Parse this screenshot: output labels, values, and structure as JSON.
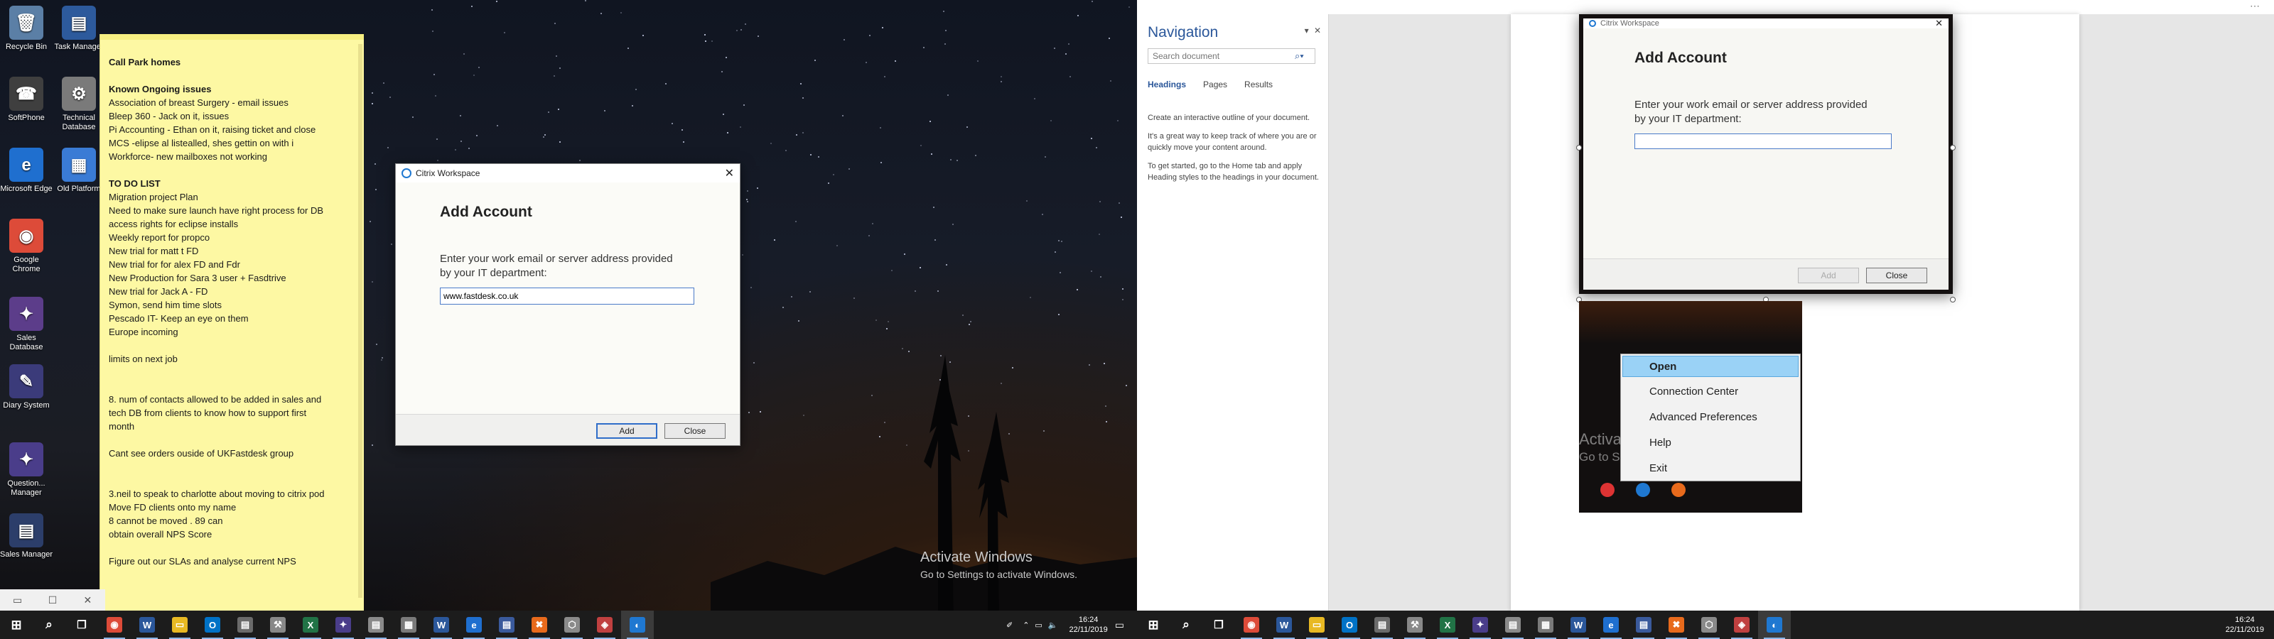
{
  "desktop_icons": [
    {
      "label": "Recycle Bin",
      "glyph": "🗑",
      "color": "#5b7fa6"
    },
    {
      "label": "Task Manager",
      "glyph": "▤",
      "color": "#2d5a9c"
    },
    {
      "label": "SoftPhone",
      "glyph": "☎",
      "color": "#3f3f3f"
    },
    {
      "label": "Technical Database",
      "glyph": "⚙",
      "color": "#7a7a7a"
    },
    {
      "label": "Microsoft Edge",
      "glyph": "e",
      "color": "#1f6fcf"
    },
    {
      "label": "Old Platform",
      "glyph": "▦",
      "color": "#3a7bd5"
    },
    {
      "label": "Google Chrome",
      "glyph": "◉",
      "color": "#dd4b39"
    },
    {
      "label": "Sales Database",
      "glyph": "✦",
      "color": "#5c3d8a"
    },
    {
      "label": "Diary System",
      "glyph": "✎",
      "color": "#3b3b7a"
    },
    {
      "label": "Question... Manager",
      "glyph": "✦",
      "color": "#4a3d8a"
    },
    {
      "label": "Sales Manager",
      "glyph": "▤",
      "color": "#2c3e6a"
    }
  ],
  "sticky_note": {
    "lines": [
      {
        "text": "Call Park homes",
        "bold": true
      },
      {
        "text": ""
      },
      {
        "text": "Known Ongoing issues",
        "bold": true
      },
      {
        "text": "Association of breast Surgery - email issues"
      },
      {
        "text": "Bleep 360 - Jack on it, issues"
      },
      {
        "text": "Pi Accounting - Ethan on it, raising ticket and close"
      },
      {
        "text": "MCS -elipse al listealled, shes gettin on with i"
      },
      {
        "text": "Workforce- new mailboxes not working"
      },
      {
        "text": ""
      },
      {
        "text": "TO DO LIST",
        "bold": true
      },
      {
        "text": "Migration project Plan"
      },
      {
        "text": "Need to make sure launch have right process for DB"
      },
      {
        "text": "access rights for eclipse installs"
      },
      {
        "text": "Weekly report for propco"
      },
      {
        "text": "New trial for matt t FD"
      },
      {
        "text": "New trial for for alex FD and Fdr"
      },
      {
        "text": "New Production for Sara 3 user + Fasdtrive"
      },
      {
        "text": "New trial for Jack A - FD"
      },
      {
        "text": "Symon, send him time slots"
      },
      {
        "text": "Pescado IT- Keep an eye on them"
      },
      {
        "text": "Europe incoming"
      },
      {
        "text": ""
      },
      {
        "text": "limits on next job"
      },
      {
        "text": ""
      },
      {
        "text": ""
      },
      {
        "text": "8. num of contacts allowed to be added in sales and"
      },
      {
        "text": "tech DB from clients to know how to support first"
      },
      {
        "text": "month"
      },
      {
        "text": ""
      },
      {
        "text": "Cant see orders ouside of UKFastdesk group"
      },
      {
        "text": ""
      },
      {
        "text": ""
      },
      {
        "text": "3.neil to speak to charlotte about moving to citrix pod"
      },
      {
        "text": "Move FD clients onto my name"
      },
      {
        "text": "8 cannot be moved . 89 can"
      },
      {
        "text": "obtain overall NPS Score"
      },
      {
        "text": ""
      },
      {
        "text": "Figure out our SLAs and analyse current NPS"
      }
    ]
  },
  "dialog1": {
    "window_title": "Citrix Workspace",
    "heading": "Add Account",
    "prompt_line1": "Enter your work email or server address provided",
    "prompt_line2": "by your IT department:",
    "input_value": "www.fastdesk.co.uk",
    "add_label": "Add",
    "close_label": "Close"
  },
  "activate_windows": {
    "line1": "Activate Windows",
    "line2": "Go to Settings to activate Windows."
  },
  "clock": {
    "time": "16:24",
    "date": "22/11/2019"
  },
  "navigation_pane": {
    "title": "Navigation",
    "search_placeholder": "Search document",
    "tabs": [
      "Headings",
      "Pages",
      "Results"
    ],
    "help": [
      "Create an interactive outline of your document.",
      "It's a great way to keep track of where you are or quickly move your content around.",
      "To get started, go to the Home tab and apply Heading styles to the headings in your document."
    ]
  },
  "dialog2": {
    "window_title": "Citrix Workspace",
    "heading": "Add Account",
    "prompt_line1": "Enter your work email or server address provided",
    "prompt_line2": "by your IT department:",
    "input_value": "",
    "add_label": "Add",
    "close_label": "Close"
  },
  "context_menu": {
    "items": [
      "Open",
      "Connection Center",
      "Advanced Preferences",
      "Help",
      "Exit"
    ]
  },
  "taskbar_apps": [
    {
      "name": "chrome-icon",
      "glyph": "◉",
      "color": "#dd4b39"
    },
    {
      "name": "word-icon",
      "glyph": "W",
      "color": "#2b579a"
    },
    {
      "name": "file-explorer-icon",
      "glyph": "▭",
      "color": "#e8b923"
    },
    {
      "name": "outlook-icon",
      "glyph": "O",
      "color": "#0072c6"
    },
    {
      "name": "notes-icon",
      "glyph": "▤",
      "color": "#6b6b6b"
    },
    {
      "name": "tools-icon",
      "glyph": "⚒",
      "color": "#888"
    },
    {
      "name": "excel-icon",
      "glyph": "X",
      "color": "#217346"
    },
    {
      "name": "app-icon",
      "glyph": "✦",
      "color": "#4a3d8a"
    },
    {
      "name": "file-icon",
      "glyph": "▤",
      "color": "#8a8a8a"
    },
    {
      "name": "server-icon",
      "glyph": "▦",
      "color": "#7a7a7a"
    },
    {
      "name": "word-doc-icon",
      "glyph": "W",
      "color": "#2b579a"
    },
    {
      "name": "edge-icon",
      "glyph": "e",
      "color": "#1f6fcf"
    },
    {
      "name": "database-icon",
      "glyph": "▤",
      "color": "#3a5a9c"
    },
    {
      "name": "screenconnect-icon",
      "glyph": "✖",
      "color": "#e86a1c"
    },
    {
      "name": "shield-icon",
      "glyph": "⬡",
      "color": "#8a8a8a"
    },
    {
      "name": "vpn-icon",
      "glyph": "◈",
      "color": "#c04040"
    },
    {
      "name": "citrix-icon",
      "glyph": "◐",
      "color": "#1f78d1"
    }
  ]
}
